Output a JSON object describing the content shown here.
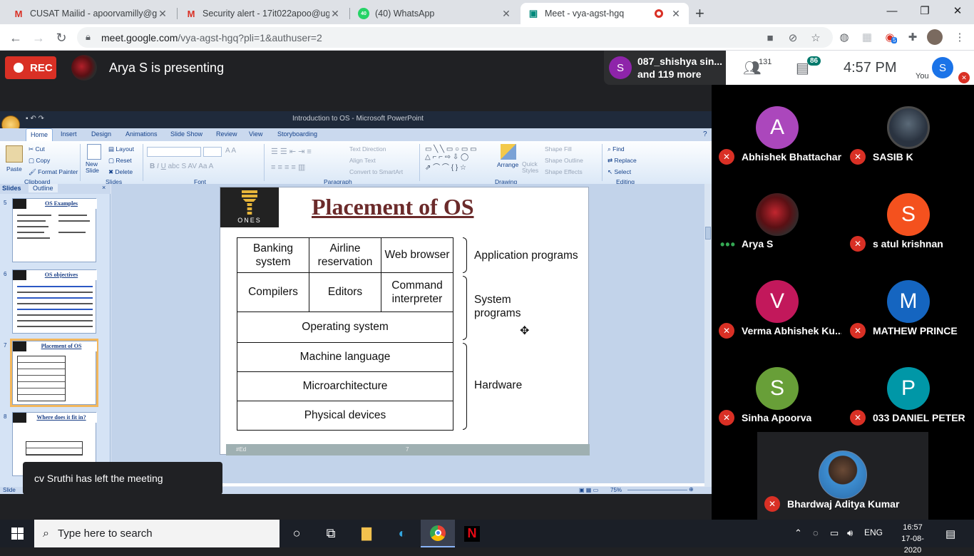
{
  "browser": {
    "tabs": [
      {
        "title": "CUSAT Mailid - apoorvamilly@gm",
        "icon": "gmail-icon",
        "active": false
      },
      {
        "title": "Security alert - 17it022apoo@ug",
        "icon": "gmail-icon",
        "active": false
      },
      {
        "title": "(40) WhatsApp",
        "icon": "whatsapp-icon",
        "badge": "40",
        "active": false
      },
      {
        "title": "Meet - vya-agst-hgq",
        "icon": "meet-icon",
        "active": true
      }
    ],
    "url_host": "meet.google.com",
    "url_path": "/vya-agst-hgq?pli=1&authuser=2",
    "extension_badge": "5",
    "colors": {
      "tabstrip": "#dee1e6",
      "accent": "#1a73e8"
    }
  },
  "meet": {
    "rec_label": "REC",
    "presenter_text": "Arya S is presenting",
    "others": {
      "avatar_letter": "S",
      "line1": "087_shishya sin...",
      "line2": "and 119 more"
    },
    "people_count": "131",
    "chat_count": "86",
    "time": "4:57 PM",
    "you_label": "You",
    "you_letter": "S",
    "toast": "cv Sruthi has left the meeting",
    "colors": {
      "rec": "#d93025",
      "mic_off": "#d93025",
      "badge": "#00796b"
    }
  },
  "powerpoint": {
    "window_title": "Introduction to OS - Microsoft PowerPoint",
    "ribbon_tabs": [
      "Home",
      "Insert",
      "Design",
      "Animations",
      "Slide Show",
      "Review",
      "View",
      "Storyboarding"
    ],
    "clipboard": {
      "paste": "Paste",
      "cut": "Cut",
      "copy": "Copy",
      "format_painter": "Format Painter",
      "group": "Clipboard"
    },
    "slides_group": {
      "new_slide": "New Slide",
      "layout": "Layout",
      "reset": "Reset",
      "delete": "Delete",
      "group": "Slides"
    },
    "font_group": "Font",
    "paragraph": {
      "text_direction": "Text Direction",
      "align_text": "Align Text",
      "smartart": "Convert to SmartArt",
      "group": "Paragraph"
    },
    "drawing": {
      "arrange": "Arrange",
      "quick_styles": "Quick Styles",
      "shape_fill": "Shape Fill",
      "shape_outline": "Shape Outline",
      "shape_effects": "Shape Effects",
      "group": "Drawing"
    },
    "editing": {
      "find": "Find",
      "replace": "Replace",
      "select": "Select",
      "group": "Editing"
    },
    "pane_tabs": [
      "Slides",
      "Outline"
    ],
    "thumbnails": [
      {
        "num": "5",
        "title": "OS Examples"
      },
      {
        "num": "6",
        "title": "OS objectives"
      },
      {
        "num": "7",
        "title": "Placement of OS"
      },
      {
        "num": "8",
        "title": "Where does it fit in?"
      }
    ],
    "zoom": "75%",
    "status_left": "Slide"
  },
  "slide": {
    "logo_text": "ONES",
    "title": "Placement of OS",
    "cells": {
      "banking": "Banking system",
      "airline": "Airline reservation",
      "web": "Web browser",
      "compilers": "Compilers",
      "editors": "Editors",
      "command": "Command interpreter",
      "os": "Operating system",
      "machine": "Machine language",
      "micro": "Microarchitecture",
      "physical": "Physical devices"
    },
    "labels": {
      "application": "Application programs",
      "system": "System programs",
      "hardware": "Hardware"
    },
    "footer_left": "#Ed",
    "footer_num": "7"
  },
  "participants": [
    {
      "name": "Abhishek Bhattachar...",
      "letter": "A",
      "color": "#ab47bc",
      "muted": true
    },
    {
      "name": "SASIB K",
      "letter": "",
      "color": "#2a3340",
      "muted": true
    },
    {
      "name": "Arya S",
      "letter": "",
      "color": "#5a1014",
      "muted": false
    },
    {
      "name": "s atul krishnan",
      "letter": "S",
      "color": "#f4511e",
      "muted": true
    },
    {
      "name": "Verma Abhishek Ku...",
      "letter": "V",
      "color": "#c2185b",
      "muted": true
    },
    {
      "name": "MATHEW PRINCE",
      "letter": "M",
      "color": "#1565c0",
      "muted": true
    },
    {
      "name": "Sinha Apoorva",
      "letter": "S",
      "color": "#689f38",
      "muted": true
    },
    {
      "name": "033 DANIEL PETER",
      "letter": "P",
      "color": "#0097a7",
      "muted": true
    }
  ],
  "big_tile": {
    "name": "Bhardwaj Aditya Kumar",
    "muted": true
  },
  "taskbar": {
    "search_placeholder": "Type here to search",
    "language": "ENG",
    "time": "16:57",
    "date": "17-08-2020"
  }
}
